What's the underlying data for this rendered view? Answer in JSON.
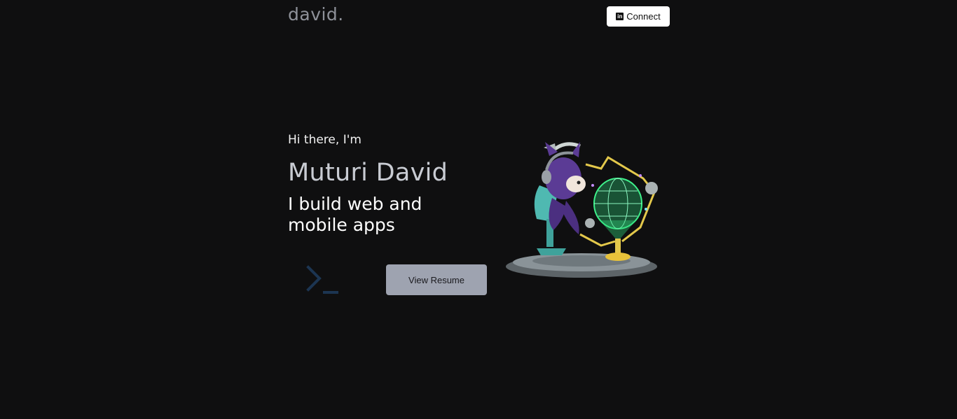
{
  "header": {
    "logo": "david.",
    "connect_label": "Connect",
    "connect_icon": "linkedin-icon"
  },
  "hero": {
    "greeting": "Hi there, I'm",
    "name": "Muturi David",
    "tagline": "I build web and mobile apps",
    "terminal_icon": "terminal-prompt-icon",
    "resume_label": "View Resume",
    "illustration": "octocat-hologram-illustration"
  },
  "colors": {
    "background": "#0f0f10",
    "logo": "#8e9199",
    "name": "#c9ccd3",
    "resume_button": "#9ea3b0",
    "terminal_icon": "#1c3552",
    "hologram": "#3ef08a"
  }
}
